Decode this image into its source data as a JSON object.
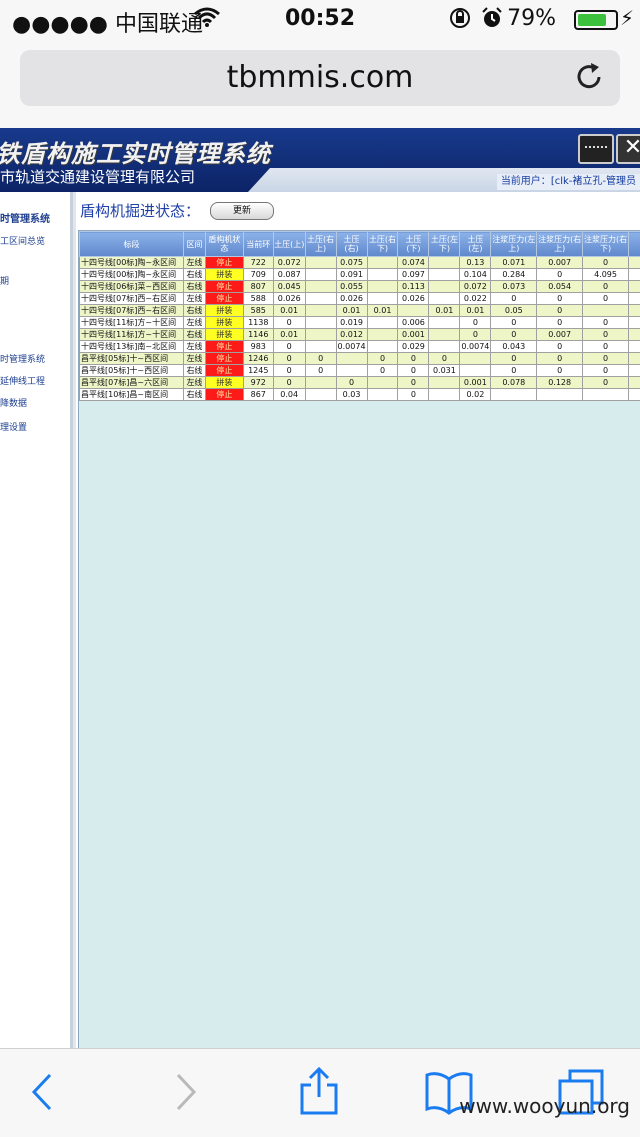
{
  "status_bar": {
    "carrier": "●●●●● 中国联通",
    "time": "00:52",
    "battery": "79%",
    "battery_level": 0.79
  },
  "browser": {
    "url": "tbmmis.com"
  },
  "banner": {
    "title": "铁盾构施工实时管理系统",
    "subtitle": "市轨道交通建设管理有限公司",
    "current_user_label": "当前用户：",
    "current_user": "[clk-褚立孔-管理员"
  },
  "sidebar": {
    "items": [
      {
        "label": "时管理系统",
        "head": true
      },
      {
        "label": "工区间总览"
      },
      {
        "label": "期"
      },
      {
        "label": "时管理系统"
      },
      {
        "label": "延伸线工程"
      },
      {
        "label": "降数据"
      },
      {
        "label": "理设置"
      }
    ]
  },
  "main": {
    "state_label": "盾构机掘进状态：",
    "refresh_label": "更新"
  },
  "table": {
    "headers": [
      "标段",
      "区间",
      "盾构机状态",
      "当前环",
      "土压(上)",
      "土压(右上)",
      "土压(右)",
      "土压(右下)",
      "土压(下)",
      "土压(左下)",
      "土压(左)",
      "注浆压力(左上)",
      "注浆压力(右上)",
      "注浆压力(右下)",
      ""
    ],
    "rows": [
      [
        "十四号线[00标]陶~永区间",
        "左线",
        "停止",
        "722",
        "0.072",
        "",
        "0.075",
        "",
        "0.074",
        "",
        "0.13",
        "0.071",
        "0.007",
        "0",
        ""
      ],
      [
        "十四号线[00标]陶~永区间",
        "右线",
        "拼装",
        "709",
        "0.087",
        "",
        "0.091",
        "",
        "0.097",
        "",
        "0.104",
        "0.284",
        "0",
        "4.095",
        ""
      ],
      [
        "十四号线[06标]菜~西区间",
        "右线",
        "停止",
        "807",
        "0.045",
        "",
        "0.055",
        "",
        "0.113",
        "",
        "0.072",
        "0.073",
        "0.054",
        "0",
        ""
      ],
      [
        "十四号线[07标]西~右区间",
        "左线",
        "停止",
        "588",
        "0.026",
        "",
        "0.026",
        "",
        "0.026",
        "",
        "0.022",
        "0",
        "0",
        "0",
        ""
      ],
      [
        "十四号线[07标]西~右区间",
        "右线",
        "拼装",
        "585",
        "0.01",
        "",
        "0.01",
        "0.01",
        "",
        "0.01",
        "0.01",
        "0.05",
        "0",
        "",
        ""
      ],
      [
        "十四号线[11标]方~十区间",
        "左线",
        "拼装",
        "1138",
        "0",
        "",
        "0.019",
        "",
        "0.006",
        "",
        "0",
        "0",
        "0",
        "0",
        ""
      ],
      [
        "十四号线[11标]方~十区间",
        "右线",
        "拼装",
        "1146",
        "0.01",
        "",
        "0.012",
        "",
        "0.001",
        "",
        "0",
        "0",
        "0.007",
        "0",
        ""
      ],
      [
        "十四号线[13标]南~北区间",
        "左线",
        "停止",
        "983",
        "0",
        "",
        "0.0074",
        "",
        "0.029",
        "",
        "0.0074",
        "0.043",
        "0",
        "0",
        ""
      ],
      [
        "昌平线[05标]十~西区间",
        "左线",
        "停止",
        "1246",
        "0",
        "0",
        "",
        "0",
        "0",
        "0",
        "",
        "0",
        "0",
        "0",
        ""
      ],
      [
        "昌平线[05标]十~西区间",
        "右线",
        "停止",
        "1245",
        "0",
        "0",
        "",
        "0",
        "0",
        "0.031",
        "",
        "0",
        "0",
        "0",
        ""
      ],
      [
        "昌平线[07标]昌~六区间",
        "左线",
        "拼装",
        "972",
        "0",
        "",
        "0",
        "",
        "0",
        "",
        "0.001",
        "0.078",
        "0.128",
        "0",
        ""
      ],
      [
        "昌平线[10标]昌~南区间",
        "右线",
        "停止",
        "867",
        "0.04",
        "",
        "0.03",
        "",
        "0",
        "",
        "0.02",
        "",
        "",
        "",
        ""
      ]
    ]
  },
  "watermark": "www.wooyun.org",
  "colors": {
    "stop": "#ff1a1a",
    "assembly": "#ffff22",
    "header": "#6f98d8",
    "banner": "#15327d"
  }
}
